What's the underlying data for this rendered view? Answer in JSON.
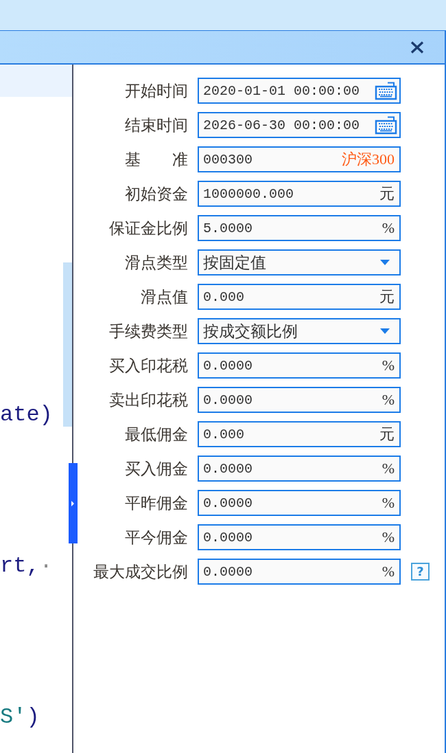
{
  "editor": {
    "lines": [
      {
        "segments": [
          {
            "text": "ate)",
            "kind": "code"
          }
        ]
      },
      {
        "segments": [
          {
            "text": "rt,",
            "kind": "code"
          },
          {
            "text": "·",
            "kind": "whitespace"
          }
        ]
      },
      {
        "segments": [
          {
            "text": "S'",
            "kind": "string"
          },
          {
            "text": ")",
            "kind": "code"
          }
        ]
      }
    ]
  },
  "form": {
    "rows": [
      {
        "label": "开始时间",
        "kind": "datetime",
        "value": "2020-01-01 00:00:00"
      },
      {
        "label": "结束时间",
        "kind": "datetime",
        "value": "2026-06-30 00:00:00"
      },
      {
        "label": "基　　准",
        "kind": "lookup",
        "value": "000300",
        "note": "沪深300"
      },
      {
        "label": "初始资金",
        "kind": "number",
        "value": "1000000.000",
        "unit": "元"
      },
      {
        "label": "保证金比例",
        "kind": "number",
        "value": "5.0000",
        "unit": "%"
      },
      {
        "label": "滑点类型",
        "kind": "select",
        "value": "按固定值"
      },
      {
        "label": "滑点值",
        "kind": "number",
        "value": "0.000",
        "unit": "元"
      },
      {
        "label": "手续费类型",
        "kind": "select",
        "value": "按成交额比例"
      },
      {
        "label": "买入印花税",
        "kind": "number",
        "value": "0.0000",
        "unit": "%"
      },
      {
        "label": "卖出印花税",
        "kind": "number",
        "value": "0.0000",
        "unit": "%"
      },
      {
        "label": "最低佣金",
        "kind": "number",
        "value": "0.000",
        "unit": "元"
      },
      {
        "label": "买入佣金",
        "kind": "number",
        "value": "0.0000",
        "unit": "%"
      },
      {
        "label": "平昨佣金",
        "kind": "number",
        "value": "0.0000",
        "unit": "%"
      },
      {
        "label": "平今佣金",
        "kind": "number",
        "value": "0.0000",
        "unit": "%"
      },
      {
        "label": "最大成交比例",
        "kind": "number",
        "value": "0.0000",
        "unit": "%",
        "help": "?"
      }
    ]
  }
}
